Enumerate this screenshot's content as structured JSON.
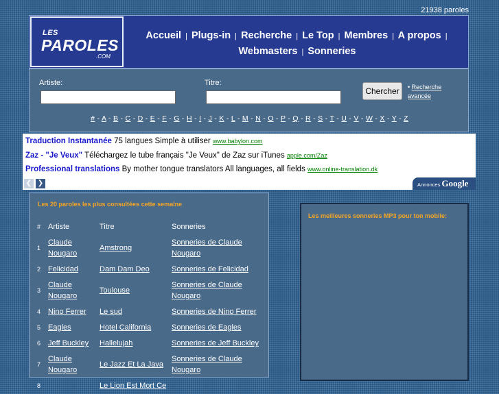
{
  "count": "21938 paroles",
  "logo": {
    "les": "LES",
    "paroles": "PAROLES",
    "com": ".COM"
  },
  "nav": [
    "Accueil",
    "Plugs-in",
    "Recherche",
    "Le Top",
    "Membres",
    "A propos",
    "Webmasters",
    "Sonneries"
  ],
  "nav_sep": "|",
  "search": {
    "artist_label": "Artiste:",
    "title_label": "Titre:",
    "button": "Chercher",
    "advanced_bullet": "•",
    "advanced": "Recherche avancée"
  },
  "alphabet": [
    "#",
    "A",
    "B",
    "C",
    "D",
    "E",
    "F",
    "G",
    "H",
    "I",
    "J",
    "K",
    "L",
    "M",
    "N",
    "O",
    "P",
    "Q",
    "R",
    "S",
    "T",
    "U",
    "V",
    "W",
    "X",
    "Y",
    "Z"
  ],
  "alphabet_sep": " - ",
  "ads": [
    {
      "title": "Traduction Instantanée",
      "text": "75 langues Simple à utiliser",
      "url": "www.babylon.com"
    },
    {
      "title": "Zaz - \"Je Veux\"",
      "text": "Téléchargez le tube français \"Je Veux\" de Zaz sur iTunes",
      "url": "apple.com/Zaz"
    },
    {
      "title": "Professional translations",
      "text": "By mother tongue translators All languages, all fields",
      "url": "www.online-translation.dk"
    }
  ],
  "ads_footer": {
    "annonces": "Annonces",
    "google": "Google",
    "prev": "❮",
    "next": "❯"
  },
  "top20": {
    "heading": "Les 20 paroles les plus consultées cette semaine",
    "headers": [
      "#",
      "Artiste",
      "Titre",
      "Sonneries"
    ],
    "rows": [
      [
        "1",
        "Claude Nougaro",
        "Amstrong",
        "Sonneries de Claude Nougaro"
      ],
      [
        "2",
        "Felicidad",
        "Dam Dam Deo",
        "Sonneries de Felicidad"
      ],
      [
        "3",
        "Claude Nougaro",
        "Toulouse",
        "Sonneries de Claude Nougaro"
      ],
      [
        "4",
        "Nino Ferrer",
        "Le sud",
        "Sonneries de Nino Ferrer"
      ],
      [
        "5",
        "Eagles",
        "Hotel California",
        "Sonneries de Eagles"
      ],
      [
        "6",
        "Jeff Buckley",
        "Hallelujah",
        "Sonneries de Jeff Buckley"
      ],
      [
        "7",
        "Claude Nougaro",
        "Le Jazz Et La Java",
        "Sonneries de Claude Nougaro"
      ],
      [
        "8",
        "",
        "Le Lion Est Mort Ce",
        ""
      ]
    ]
  },
  "ringtones": {
    "heading": "Les meilleures sonneries MP3 pour ton mobile:"
  },
  "colors": {
    "background": "#2a5680",
    "header": "#263a91",
    "panel": "#4a6a8a",
    "accent": "#f5a623",
    "ad_title": "#1a1acc",
    "ad_url": "#008000"
  }
}
